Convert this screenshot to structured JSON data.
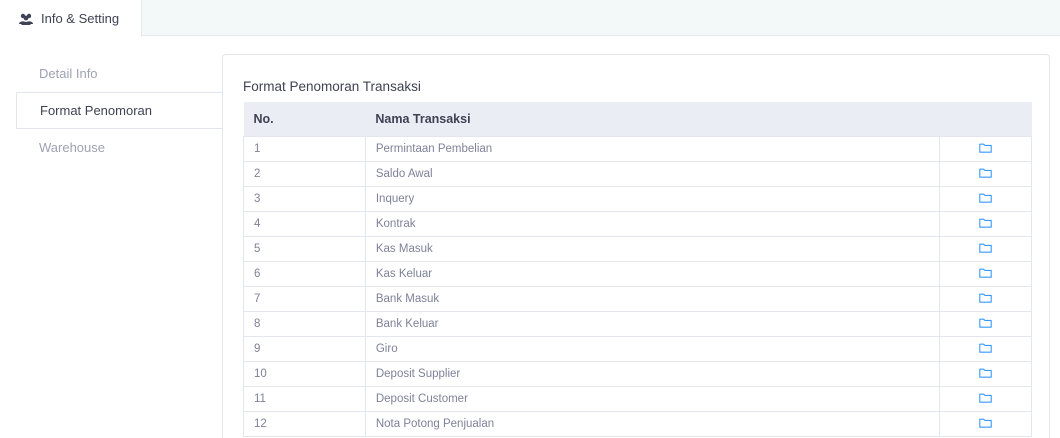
{
  "tab": {
    "label": "Info & Setting",
    "icon": "users-icon"
  },
  "sidebar": {
    "items": [
      {
        "label": "Detail Info",
        "active": false
      },
      {
        "label": "Format Penomoran",
        "active": true
      },
      {
        "label": "Warehouse",
        "active": false
      }
    ]
  },
  "panel": {
    "title": "Format Penomoran Transaksi",
    "columns": [
      "No.",
      "Nama Transaksi",
      ""
    ],
    "rows": [
      {
        "no": "1",
        "name": "Permintaan Pembelian"
      },
      {
        "no": "2",
        "name": "Saldo Awal"
      },
      {
        "no": "3",
        "name": "Inquery"
      },
      {
        "no": "4",
        "name": "Kontrak"
      },
      {
        "no": "5",
        "name": "Kas Masuk"
      },
      {
        "no": "6",
        "name": "Kas Keluar"
      },
      {
        "no": "7",
        "name": "Bank Masuk"
      },
      {
        "no": "8",
        "name": "Bank Keluar"
      },
      {
        "no": "9",
        "name": "Giro"
      },
      {
        "no": "10",
        "name": "Deposit Supplier"
      },
      {
        "no": "11",
        "name": "Deposit Customer"
      },
      {
        "no": "12",
        "name": "Nota Potong Penjualan"
      }
    ],
    "row_action_icon": "folder-icon"
  },
  "colors": {
    "accent": "#3699ff",
    "header_bg": "#eaedf3",
    "topbar_bg": "#f3f9f8"
  }
}
